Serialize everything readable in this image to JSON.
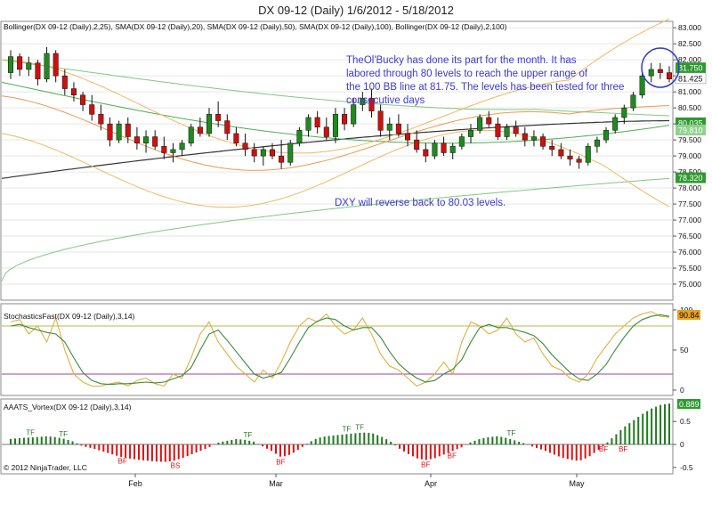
{
  "title": "DX 09-12 (Daily)  1/6/2012 - 5/18/2012",
  "copyright": "© 2012 NinjaTrader, LLC",
  "colors": {
    "bull": "#1f8a1f",
    "bear": "#cc1111",
    "bb100": "#7fc97f",
    "bb25": "#f0b860",
    "sma20": "#e89a50",
    "sma50": "#4caf50",
    "sma100": "#333333",
    "annotation": "#3a3ad0",
    "stoch_d": "#3a8a3a",
    "stoch_k": "#e0b040",
    "overbought": "#b8b850",
    "oversold": "#a040a0",
    "vortex_pos": "#1f7a1f",
    "vortex_neg": "#dd1111"
  },
  "panels": {
    "price": {
      "label": "Bollinger(DX 09-12 (Daily),2,25), SMA(DX 09-12 (Daily),20), SMA(DX 09-12 (Daily),50), SMA(DX 09-12 (Daily),100), Bollinger(DX 09-12 (Daily),2,100)",
      "yticks": [
        "83.000",
        "82.500",
        "82.000",
        "81.500",
        "81.000",
        "80.500",
        "80.000",
        "79.500",
        "79.000",
        "78.500",
        "78.000",
        "77.500",
        "77.000",
        "76.500",
        "76.000",
        "75.500",
        "75.000"
      ],
      "annotation_1": [
        "TheOl'Bucky has done its part for the month. It has",
        "labored through 80 levels to reach the upper range of",
        "the 100 BB line at 81.75. The levels has been tested for three",
        "consecutive days"
      ],
      "annotation_2": "DXY will reverse back to 80.03 levels.",
      "badges": [
        {
          "text": "81.750",
          "value": 81.75,
          "color": "#2e9a2e",
          "fg": "#ffffff"
        },
        {
          "text": "81.425",
          "value": 81.425,
          "color": "#ffffff",
          "fg": "#111111"
        },
        {
          "text": "80.035",
          "value": 80.035,
          "color": "#2e9a2e",
          "fg": "#ffffff"
        },
        {
          "text": "79.810",
          "value": 79.81,
          "color": "#8fd08f",
          "fg": "#ffffff"
        },
        {
          "text": "78.320",
          "value": 78.32,
          "color": "#2e9a2e",
          "fg": "#ffffff"
        }
      ]
    },
    "stoch": {
      "label": "StochasticsFast(DX 09-12 (Daily),3,14)",
      "yticks": [
        "100",
        "50",
        "0"
      ],
      "badge": "90.84"
    },
    "vortex": {
      "label": "AAATS_Vortex(DX 09-12 (Daily),3,14)",
      "yticks": [
        "0.5",
        "0",
        "-0.5"
      ],
      "badge": "0.889"
    }
  },
  "x_labels": [
    "Feb",
    "Mar",
    "Apr",
    "May"
  ],
  "chart_data": [
    {
      "type": "candlestick",
      "title": "DX 09-12 (Daily)  1/6/2012 - 5/18/2012",
      "ylim": [
        74.5,
        83.2
      ],
      "series_ohlc": [
        [
          81.6,
          82.3,
          81.4,
          82.1
        ],
        [
          82.1,
          82.2,
          81.5,
          81.7
        ],
        [
          81.7,
          82.1,
          81.5,
          81.9
        ],
        [
          81.9,
          82.0,
          81.2,
          81.4
        ],
        [
          81.4,
          82.4,
          81.3,
          82.2
        ],
        [
          82.2,
          82.3,
          81.3,
          81.5
        ],
        [
          81.5,
          81.7,
          80.9,
          81.1
        ],
        [
          81.1,
          81.3,
          80.7,
          80.9
        ],
        [
          80.9,
          81.0,
          80.4,
          80.6
        ],
        [
          80.6,
          80.9,
          80.1,
          80.3
        ],
        [
          80.3,
          80.6,
          79.8,
          80.0
        ],
        [
          80.0,
          80.2,
          79.3,
          79.5
        ],
        [
          79.5,
          80.1,
          79.4,
          80.0
        ],
        [
          80.0,
          80.2,
          79.4,
          79.6
        ],
        [
          79.6,
          79.9,
          79.2,
          79.4
        ],
        [
          79.4,
          79.8,
          79.1,
          79.6
        ],
        [
          79.6,
          79.8,
          79.2,
          79.3
        ],
        [
          79.3,
          79.6,
          78.9,
          79.1
        ],
        [
          79.1,
          79.4,
          78.8,
          79.2
        ],
        [
          79.2,
          79.5,
          79.0,
          79.4
        ],
        [
          79.4,
          80.0,
          79.3,
          79.9
        ],
        [
          79.9,
          80.2,
          79.6,
          79.7
        ],
        [
          79.7,
          80.5,
          79.6,
          80.3
        ],
        [
          80.3,
          80.7,
          79.9,
          80.1
        ],
        [
          80.1,
          80.3,
          79.5,
          79.7
        ],
        [
          79.7,
          79.9,
          79.3,
          79.4
        ],
        [
          79.4,
          79.7,
          79.0,
          79.2
        ],
        [
          79.2,
          79.4,
          78.8,
          79.0
        ],
        [
          79.0,
          79.3,
          78.7,
          79.2
        ],
        [
          79.2,
          79.4,
          78.9,
          79.0
        ],
        [
          79.0,
          79.5,
          78.6,
          78.8
        ],
        [
          78.8,
          79.5,
          78.7,
          79.4
        ],
        [
          79.4,
          79.9,
          79.3,
          79.8
        ],
        [
          79.8,
          80.3,
          79.6,
          80.2
        ],
        [
          80.2,
          80.4,
          79.7,
          79.9
        ],
        [
          79.9,
          80.2,
          79.5,
          79.6
        ],
        [
          79.6,
          80.5,
          79.4,
          80.3
        ],
        [
          80.3,
          80.5,
          79.8,
          80.0
        ],
        [
          80.0,
          80.8,
          79.9,
          80.6
        ],
        [
          80.6,
          81.0,
          80.4,
          80.8
        ],
        [
          80.8,
          81.1,
          80.2,
          80.4
        ],
        [
          80.4,
          80.6,
          79.6,
          79.8
        ],
        [
          79.8,
          80.2,
          79.5,
          80.0
        ],
        [
          80.0,
          80.3,
          79.6,
          79.7
        ],
        [
          79.7,
          80.0,
          79.3,
          79.5
        ],
        [
          79.5,
          79.8,
          79.1,
          79.2
        ],
        [
          79.2,
          79.4,
          78.8,
          79.0
        ],
        [
          79.0,
          79.5,
          78.9,
          79.4
        ],
        [
          79.4,
          79.6,
          79.0,
          79.1
        ],
        [
          79.1,
          79.4,
          78.9,
          79.3
        ],
        [
          79.3,
          79.7,
          79.2,
          79.6
        ],
        [
          79.6,
          80.0,
          79.4,
          79.8
        ],
        [
          79.8,
          80.3,
          79.7,
          80.2
        ],
        [
          80.2,
          80.4,
          79.9,
          80.0
        ],
        [
          80.0,
          80.2,
          79.5,
          79.6
        ],
        [
          79.6,
          80.0,
          79.5,
          79.9
        ],
        [
          79.9,
          80.1,
          79.6,
          79.7
        ],
        [
          79.7,
          79.9,
          79.3,
          79.5
        ],
        [
          79.5,
          79.8,
          79.3,
          79.6
        ],
        [
          79.6,
          79.7,
          79.2,
          79.3
        ],
        [
          79.3,
          79.5,
          79.0,
          79.2
        ],
        [
          79.2,
          79.4,
          78.9,
          79.0
        ],
        [
          79.0,
          79.2,
          78.7,
          78.9
        ],
        [
          78.9,
          79.0,
          78.6,
          78.8
        ],
        [
          78.8,
          79.4,
          78.7,
          79.3
        ],
        [
          79.3,
          79.6,
          79.1,
          79.5
        ],
        [
          79.5,
          79.9,
          79.4,
          79.8
        ],
        [
          79.8,
          80.3,
          79.7,
          80.2
        ],
        [
          80.2,
          80.6,
          80.0,
          80.5
        ],
        [
          80.5,
          81.0,
          80.4,
          80.9
        ],
        [
          80.9,
          81.6,
          80.8,
          81.5
        ],
        [
          81.5,
          81.9,
          81.3,
          81.7
        ],
        [
          81.7,
          81.9,
          81.4,
          81.6
        ],
        [
          81.6,
          81.8,
          81.3,
          81.4
        ]
      ]
    },
    {
      "type": "line",
      "title": "StochasticsFast(DX 09-12 (Daily),3,14)",
      "ylim": [
        0,
        100
      ],
      "series": [
        {
          "name": "K",
          "values": [
            85,
            88,
            70,
            80,
            60,
            90,
            50,
            20,
            10,
            5,
            5,
            8,
            10,
            5,
            12,
            15,
            8,
            5,
            20,
            15,
            40,
            70,
            85,
            60,
            45,
            30,
            20,
            10,
            25,
            15,
            35,
            60,
            80,
            90,
            85,
            95,
            80,
            70,
            75,
            90,
            70,
            45,
            30,
            25,
            15,
            5,
            10,
            20,
            35,
            20,
            60,
            85,
            80,
            70,
            75,
            90,
            70,
            60,
            65,
            45,
            30,
            25,
            15,
            10,
            20,
            40,
            55,
            70,
            80,
            90,
            95,
            98,
            92,
            91
          ]
        },
        {
          "name": "D",
          "values": [
            80,
            82,
            78,
            75,
            72,
            70,
            60,
            40,
            22,
            12,
            8,
            7,
            8,
            8,
            9,
            10,
            9,
            10,
            14,
            18,
            28,
            50,
            70,
            75,
            62,
            48,
            34,
            20,
            15,
            18,
            22,
            40,
            60,
            78,
            86,
            90,
            88,
            80,
            75,
            78,
            78,
            66,
            48,
            33,
            23,
            15,
            10,
            12,
            20,
            26,
            38,
            60,
            78,
            82,
            78,
            78,
            75,
            72,
            68,
            58,
            44,
            33,
            22,
            14,
            12,
            20,
            32,
            50,
            66,
            80,
            88,
            92,
            94,
            92
          ]
        }
      ]
    },
    {
      "type": "bar",
      "title": "AAATS_Vortex(DX 09-12 (Daily),3,14)",
      "ylim": [
        -0.6,
        0.95
      ],
      "values": [
        0.12,
        0.14,
        0.15,
        0.16,
        0.18,
        0.16,
        0.12,
        0.06,
        -0.04,
        -0.08,
        -0.14,
        -0.2,
        -0.26,
        -0.3,
        -0.33,
        -0.35,
        -0.37,
        -0.38,
        -0.36,
        -0.3,
        -0.22,
        -0.14,
        -0.06,
        0.04,
        0.08,
        0.12,
        0.1,
        0.06,
        -0.05,
        -0.15,
        -0.28,
        -0.22,
        -0.1,
        0.04,
        0.14,
        0.18,
        0.2,
        0.22,
        0.24,
        0.26,
        0.25,
        0.18,
        0.08,
        -0.08,
        -0.2,
        -0.3,
        -0.34,
        -0.3,
        -0.22,
        -0.14,
        -0.06,
        0.05,
        0.12,
        0.16,
        0.18,
        0.14,
        0.08,
        0.02,
        -0.06,
        -0.12,
        -0.2,
        -0.28,
        -0.33,
        -0.36,
        -0.28,
        -0.14,
        0.02,
        0.2,
        0.38,
        0.52,
        0.66,
        0.78,
        0.86,
        0.889
      ]
    }
  ],
  "tf_bf_markers": [
    {
      "text": "TF",
      "i": 3,
      "kind": "top"
    },
    {
      "text": "TF",
      "i": 8,
      "kind": "top"
    },
    {
      "text": "BF",
      "i": 17,
      "kind": "bottom"
    },
    {
      "text": "BS",
      "i": 25,
      "kind": "bottom"
    },
    {
      "text": "TF",
      "i": 36,
      "kind": "top"
    },
    {
      "text": "BF",
      "i": 41,
      "kind": "bottom"
    },
    {
      "text": "TF",
      "i": 51,
      "kind": "top"
    },
    {
      "text": "TF",
      "i": 53,
      "kind": "top"
    },
    {
      "text": "BF",
      "i": 63,
      "kind": "bottom"
    },
    {
      "text": "BF",
      "i": 67,
      "kind": "bottom"
    },
    {
      "text": "TF",
      "i": 76,
      "kind": "top"
    },
    {
      "text": "BF",
      "i": 90,
      "kind": "bottom"
    },
    {
      "text": "BF",
      "i": 93,
      "kind": "bottom"
    }
  ]
}
